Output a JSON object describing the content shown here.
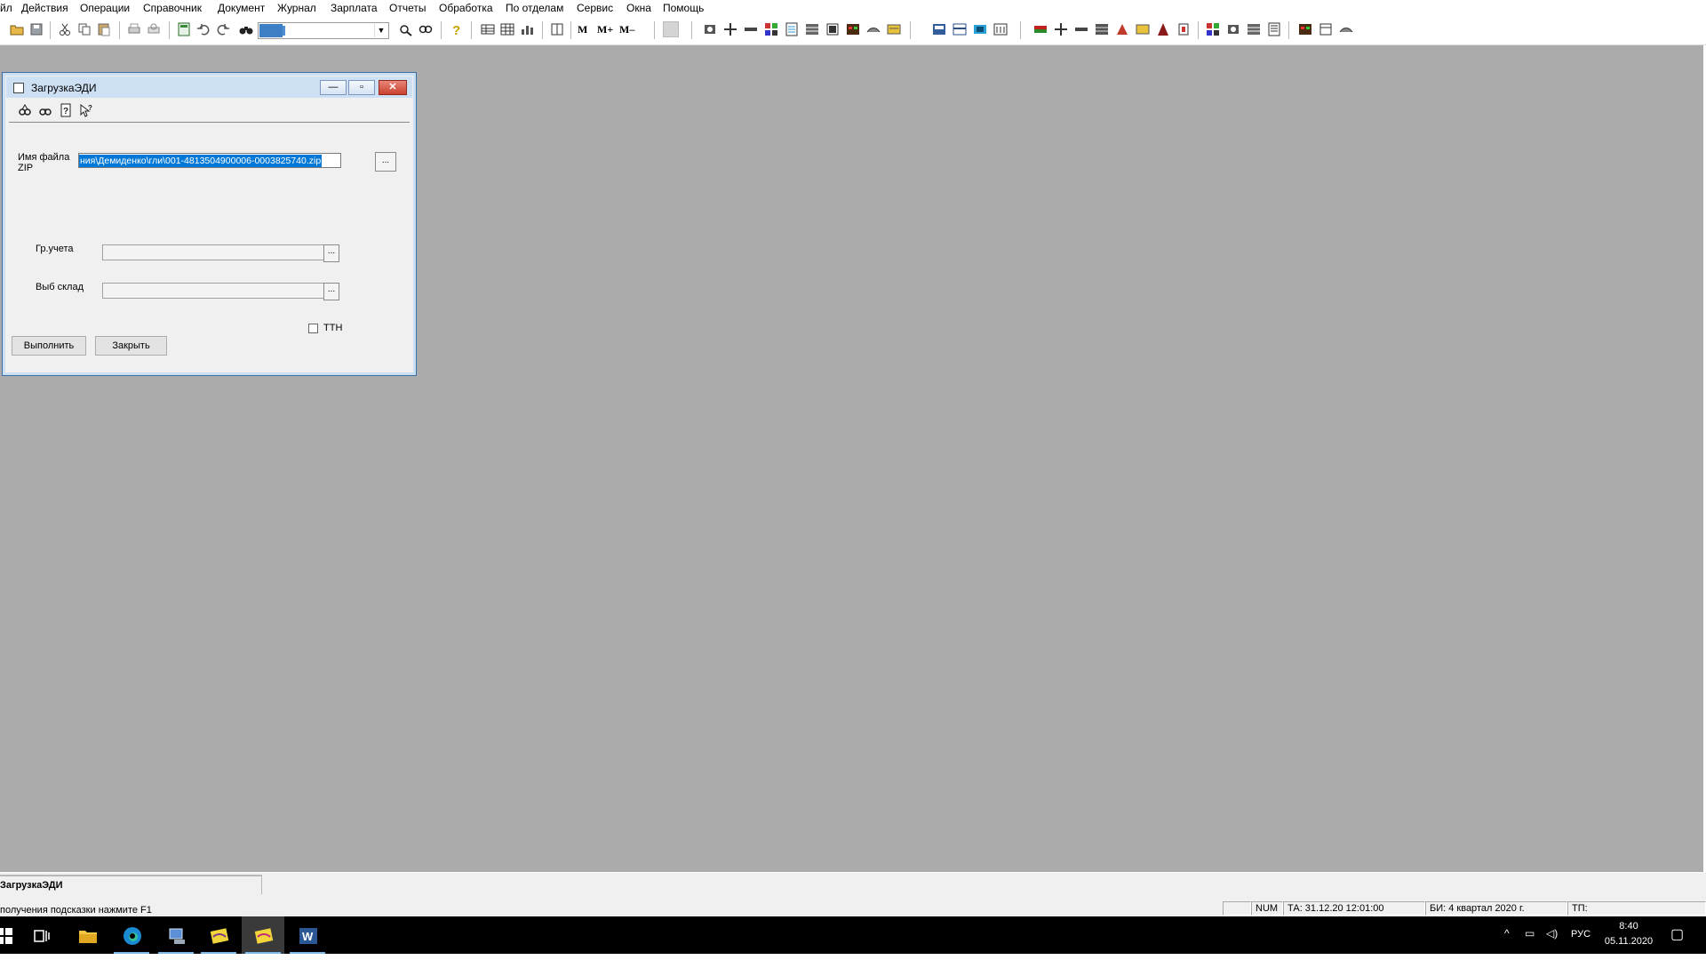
{
  "menu": {
    "items": [
      "йл",
      "Действия",
      "Операции",
      "Справочник",
      "Документ",
      "Журнал",
      "Зарплата",
      "Отчеты",
      "Обработка",
      "По отделам",
      "Сервис",
      "Окна",
      "Помощь"
    ]
  },
  "toolbar": {
    "buttons": [
      "open-icon",
      "save-icon",
      "cut-icon",
      "copy-icon",
      "paste-icon",
      "print-icon",
      "preview-icon",
      "calculator-icon",
      "undo-icon",
      "redo-icon",
      "binoculars-icon",
      "find-icon",
      "find-next-icon",
      "help-icon",
      "table-icon",
      "grid-icon",
      "chart-icon",
      "book-icon",
      "memory-icon",
      "memory-plus-icon",
      "memory-minus-icon"
    ],
    "memory_labels": [
      "M",
      "M+",
      "M–"
    ]
  },
  "child_window": {
    "title": "ЗагрузкаЭДИ",
    "minimize_label": "—",
    "restore_label": "▫",
    "close_label": "✕",
    "zip_label_line1": "Имя файла",
    "zip_label_line2": "ZIP",
    "zip_value": "ния\\Демиденко\\гли\\001-4813504900006-0003825740.zip",
    "browse_label": "...",
    "account_group_label": "Гр.учета",
    "account_group_value": "",
    "warehouse_label": "Выб склад",
    "warehouse_value": "",
    "ttn_label": "ТТН",
    "ttn_checked": false,
    "run_button": "Выполнить",
    "close_button": "Закрыть"
  },
  "tab_strip": {
    "active_tab": "ЗагрузкаЭДИ"
  },
  "statusbar": {
    "hint": "получения подсказки нажмите F1",
    "num": "NUM",
    "ta": "ТА: 31.12.20  12:01:00",
    "bi": "БИ: 4 квартал 2020 г.",
    "tp": "ТП:"
  },
  "taskbar": {
    "apps": [
      "start-icon",
      "task-view-icon",
      "file-explorer-icon",
      "edge-icon",
      "computer-app-icon",
      "accounting-app-icon",
      "accounting-app-active-icon",
      "word-icon"
    ],
    "lang": "РУС",
    "time": "8:40",
    "date": "05.11.2020"
  }
}
